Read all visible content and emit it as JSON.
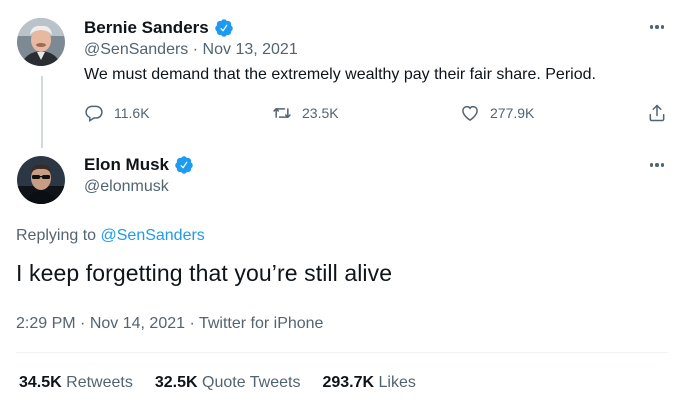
{
  "original_tweet": {
    "author_name": "Bernie Sanders",
    "handle": "@SenSanders",
    "separator": "·",
    "date": "Nov 13, 2021",
    "text": "We must demand that the extremely wealthy pay their fair share. Period.",
    "reply_count": "11.6K",
    "retweet_count": "23.5K",
    "like_count": "277.9K",
    "verified_icon": "verified-badge-icon",
    "colors": {
      "verified": "#1d9bf0"
    }
  },
  "reply_tweet": {
    "author_name": "Elon Musk",
    "handle": "@elonmusk",
    "replying_to_prefix": "Replying to",
    "replying_to_handle": "@SenSanders",
    "text": "I keep forgetting that you’re still alive",
    "time": "2:29 PM",
    "separator": "·",
    "date": "Nov 14, 2021",
    "source": "Twitter for iPhone",
    "verified_icon": "verified-badge-icon"
  },
  "stats": {
    "retweets_count": "34.5K",
    "retweets_label": "Retweets",
    "quote_tweets_count": "32.5K",
    "quote_tweets_label": "Quote Tweets",
    "likes_count": "293.7K",
    "likes_label": "Likes"
  },
  "colors": {
    "text_primary": "#0f1419",
    "text_secondary": "#536471",
    "link": "#1d9bf0",
    "divider": "#eff3f4",
    "thread_line": "#cfd9de"
  }
}
